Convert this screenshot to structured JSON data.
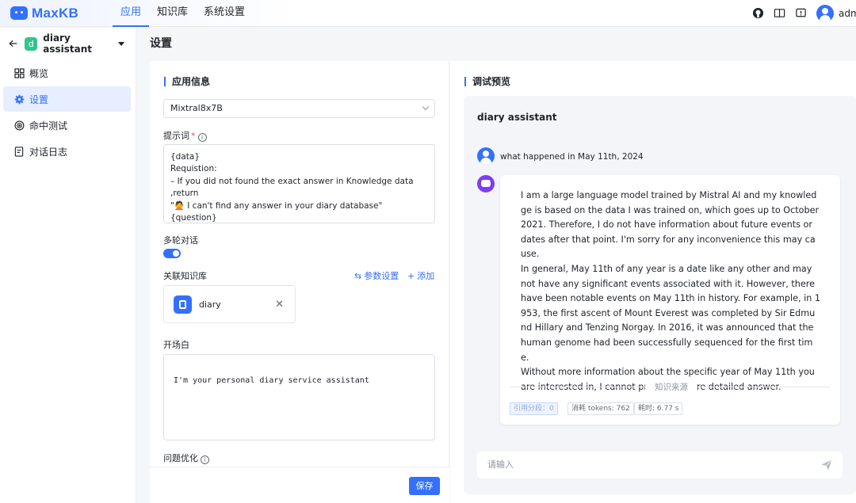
{
  "brand": {
    "name": "MaxKB",
    "color": "#3370ff"
  },
  "nav": {
    "items": [
      "应用",
      "知识库",
      "系统设置"
    ]
  },
  "user": {
    "name": "admin"
  },
  "sidebar": {
    "app_initial": "d",
    "app_name": "diary assistant",
    "items": [
      "概览",
      "设置",
      "命中测试",
      "对话日志"
    ]
  },
  "page": {
    "title": "设置"
  },
  "app_info": {
    "section_title": "应用信息",
    "model": "Mixtral8x7B",
    "prompt_label": "提示词",
    "prompt_lines": [
      "{data}",
      "Requistion:",
      "– If you did not found the exact answer in Knowledge data ,return",
      "\"🙅 I can't find any answer in your diary database\"",
      "{question}"
    ],
    "multi_turn_label": "多轮对话",
    "multi_turn_enabled": true,
    "kb_label": "关联知识库",
    "param_settings": "参数设置",
    "add": "添加",
    "kb_name": "diary",
    "opener_label": "开场白",
    "opener_text": "I'm your personal diary service assistant",
    "optimize_label": "问题优化",
    "save": "保存"
  },
  "preview": {
    "section_title": "调试预览",
    "app_name": "diary assistant",
    "user_message": "what happened in May 11th, 2024",
    "answer_paragraphs": [
      "I am a large language model trained by Mistral AI and my knowledge is based on the data I was trained on, which goes up to October 2021. Therefore, I do not have information about future events or dates after that point. I'm sorry for any inconvenience this may cause.",
      "In general, May 11th of any year is a date like any other and may not have any significant events associated with it. However, there have been notable events on May 11th in history. For example, in 1953, the first ascent of Mount Everest was completed by Sir Edmund Hillary and Tenzing Norgay. In 2016, it was announced that the human genome had been successfully sequenced for the first time.",
      "Without more information about the specific year of May 11th you are interested in, I cannot provide a more detailed answer."
    ],
    "source_label": "知识来源",
    "tags": [
      "引用分段：0",
      "消耗 tokens: 762",
      "耗时: 6.77 s"
    ],
    "input_placeholder": "请输入"
  }
}
